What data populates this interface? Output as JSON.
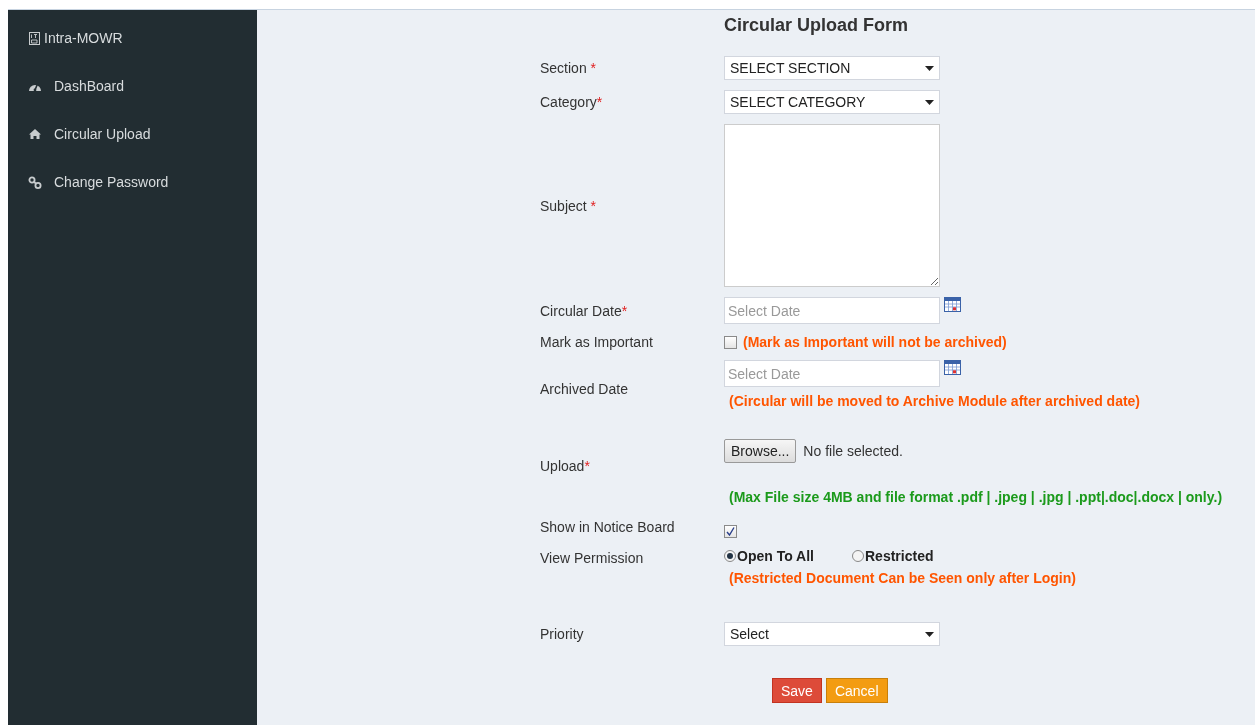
{
  "sidebar": {
    "brand": "Intra-MOWR",
    "items": [
      {
        "label": "DashBoard",
        "kind": "dashboard",
        "selected": false
      },
      {
        "label": "Circular Upload",
        "kind": "home",
        "selected": false
      },
      {
        "label": "Change Password",
        "kind": "link",
        "selected": false
      }
    ]
  },
  "form": {
    "title": "Circular Upload Form",
    "fields": [
      {
        "kind": "select",
        "label": "Section",
        "mark": " *",
        "value": "SELECT SECTION"
      },
      {
        "kind": "select",
        "label": "Category",
        "mark": "*",
        "value": "SELECT CATEGORY"
      },
      {
        "kind": "textarea",
        "label": "Subject",
        "mark": " *"
      },
      {
        "kind": "date",
        "label": "Circular Date",
        "mark": "*",
        "placeholder": "Select Date"
      },
      {
        "kind": "checkbox",
        "label": "Mark as Important",
        "checked": false,
        "note": "(Mark as Important will not be archived)"
      },
      {
        "kind": "date",
        "label": "Archived Date",
        "placeholder": "Select Date",
        "note": "(Circular will be moved to Archive Module after archived date)"
      },
      {
        "kind": "file",
        "label": "Upload",
        "mark": "*",
        "button": "Browse...",
        "status": "No file selected.",
        "note": "(Max File size 4MB and file format .pdf | .jpeg | .jpg | .ppt|.doc|.docx | only.)"
      },
      {
        "kind": "checkbox",
        "label": "Show in Notice Board",
        "checked": true
      },
      {
        "kind": "radio",
        "label": "View Permission",
        "options": [
          {
            "label": "Open To All",
            "selected": true
          },
          {
            "label": "Restricted",
            "selected": false
          }
        ],
        "note": "(Restricted Document Can be Seen only after Login)"
      },
      {
        "kind": "select",
        "label": "Priority",
        "value": "Select"
      }
    ],
    "buttons": [
      {
        "label": "Save",
        "kind": "danger"
      },
      {
        "label": "Cancel",
        "kind": "warning"
      }
    ]
  }
}
